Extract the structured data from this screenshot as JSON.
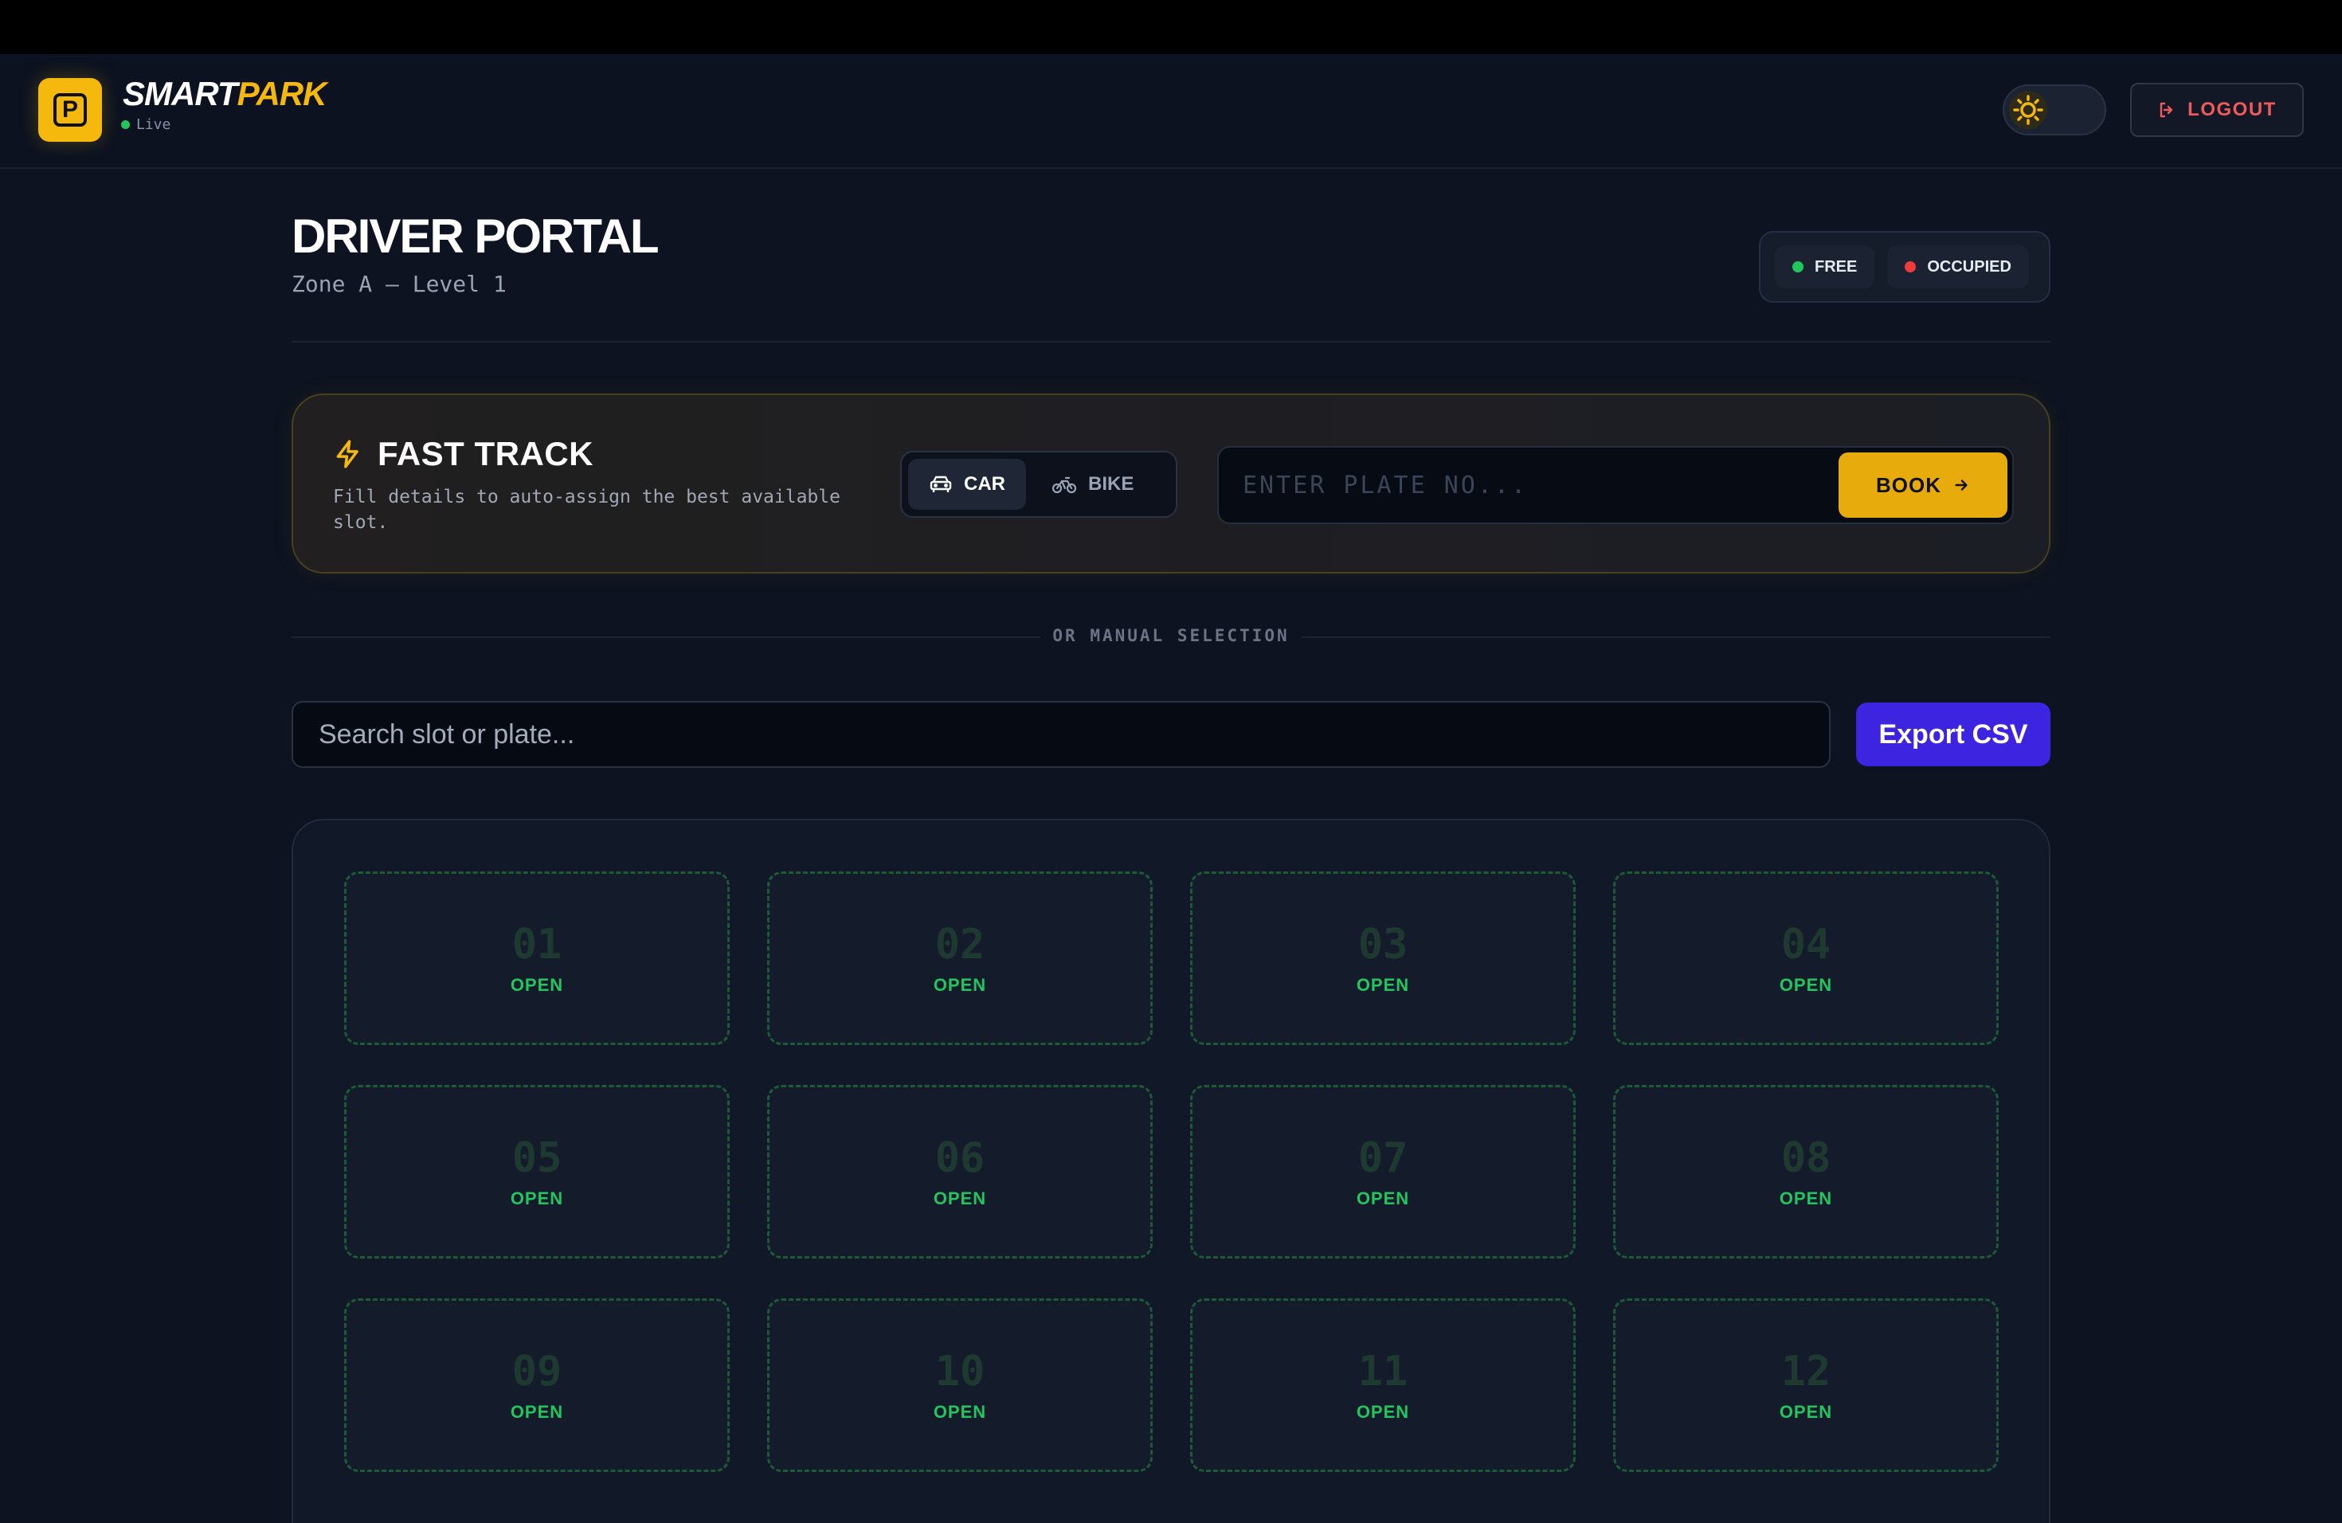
{
  "app": {
    "brand_part1": "SMART",
    "brand_part2": "PARK",
    "logo_letter": "P",
    "status_label": "Live",
    "logout_label": "LOGOUT"
  },
  "page": {
    "title": "DRIVER PORTAL",
    "subtitle": "Zone A — Level 1"
  },
  "legend": [
    {
      "label": "FREE",
      "color": "#22c55e"
    },
    {
      "label": "OCCUPIED",
      "color": "#ef3b3b"
    }
  ],
  "fast_track": {
    "title": "FAST TRACK",
    "description": "Fill details to auto-assign the best available slot.",
    "vehicle_types": [
      {
        "label": "CAR",
        "icon": "car-icon",
        "selected": true
      },
      {
        "label": "BIKE",
        "icon": "bike-icon",
        "selected": false
      }
    ],
    "plate_placeholder": "ENTER PLATE NO...",
    "plate_value": "",
    "book_label": "BOOK"
  },
  "divider_label": "OR MANUAL SELECTION",
  "search": {
    "placeholder": "Search slot or plate...",
    "value": ""
  },
  "export_label": "Export CSV",
  "slots": [
    {
      "number": "01",
      "status": "OPEN"
    },
    {
      "number": "02",
      "status": "OPEN"
    },
    {
      "number": "03",
      "status": "OPEN"
    },
    {
      "number": "04",
      "status": "OPEN"
    },
    {
      "number": "05",
      "status": "OPEN"
    },
    {
      "number": "06",
      "status": "OPEN"
    },
    {
      "number": "07",
      "status": "OPEN"
    },
    {
      "number": "08",
      "status": "OPEN"
    },
    {
      "number": "09",
      "status": "OPEN"
    },
    {
      "number": "10",
      "status": "OPEN"
    },
    {
      "number": "11",
      "status": "OPEN"
    },
    {
      "number": "12",
      "status": "OPEN"
    }
  ],
  "colors": {
    "accent": "#f5b80c",
    "free": "#22c55e",
    "occupied": "#ef3b3b",
    "export": "#3c24e0",
    "logout": "#f05a5a"
  }
}
